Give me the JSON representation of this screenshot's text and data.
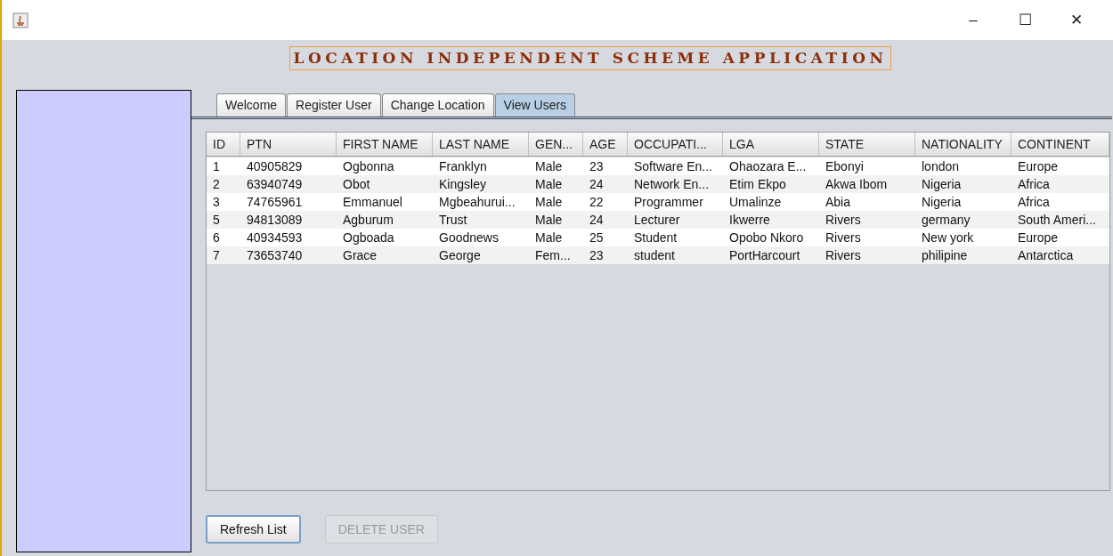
{
  "window": {
    "title_bar_buttons": [
      "–",
      "☐",
      "✕"
    ]
  },
  "banner": {
    "title": "LOCATION INDEPENDENT SCHEME APPLICATION"
  },
  "tabs": [
    {
      "label": "Welcome",
      "selected": false
    },
    {
      "label": "Register User",
      "selected": false
    },
    {
      "label": "Change Location",
      "selected": false
    },
    {
      "label": "View Users",
      "selected": true
    }
  ],
  "table": {
    "columns": [
      "ID",
      "PTN",
      "FIRST NAME",
      "LAST NAME",
      "GEN...",
      "AGE",
      "OCCUPATI...",
      "LGA",
      "STATE",
      "NATIONALITY",
      "CONTINENT"
    ],
    "rows": [
      [
        "1",
        "40905829",
        "Ogbonna",
        "Franklyn",
        "Male",
        "23",
        "Software En...",
        "Ohaozara E...",
        "Ebonyi",
        "london",
        "Europe"
      ],
      [
        "2",
        "63940749",
        "Obot",
        "Kingsley",
        "Male",
        "24",
        "Network En...",
        "Etim Ekpo",
        "Akwa Ibom",
        "Nigeria",
        "Africa"
      ],
      [
        "3",
        "74765961",
        "Emmanuel",
        "Mgbeahurui...",
        "Male",
        "22",
        "Programmer",
        "Umalinze",
        "Abia",
        "Nigeria",
        "Africa"
      ],
      [
        "5",
        "94813089",
        "Agburum",
        "Trust",
        "Male",
        "24",
        "Lecturer",
        "Ikwerre",
        "Rivers",
        "germany",
        "South Ameri..."
      ],
      [
        "6",
        "40934593",
        "Ogboada",
        "Goodnews",
        "Male",
        "25",
        "Student",
        "Opobo Nkoro",
        "Rivers",
        "New york",
        "Europe"
      ],
      [
        "7",
        "73653740",
        "Grace",
        "George",
        "Fem...",
        "23",
        "student",
        "PortHarcourt",
        "Rivers",
        "philipine",
        "Antarctica"
      ]
    ]
  },
  "buttons": [
    {
      "label": "Refresh List",
      "disabled": false
    },
    {
      "label": "DELETE USER",
      "disabled": true
    }
  ]
}
